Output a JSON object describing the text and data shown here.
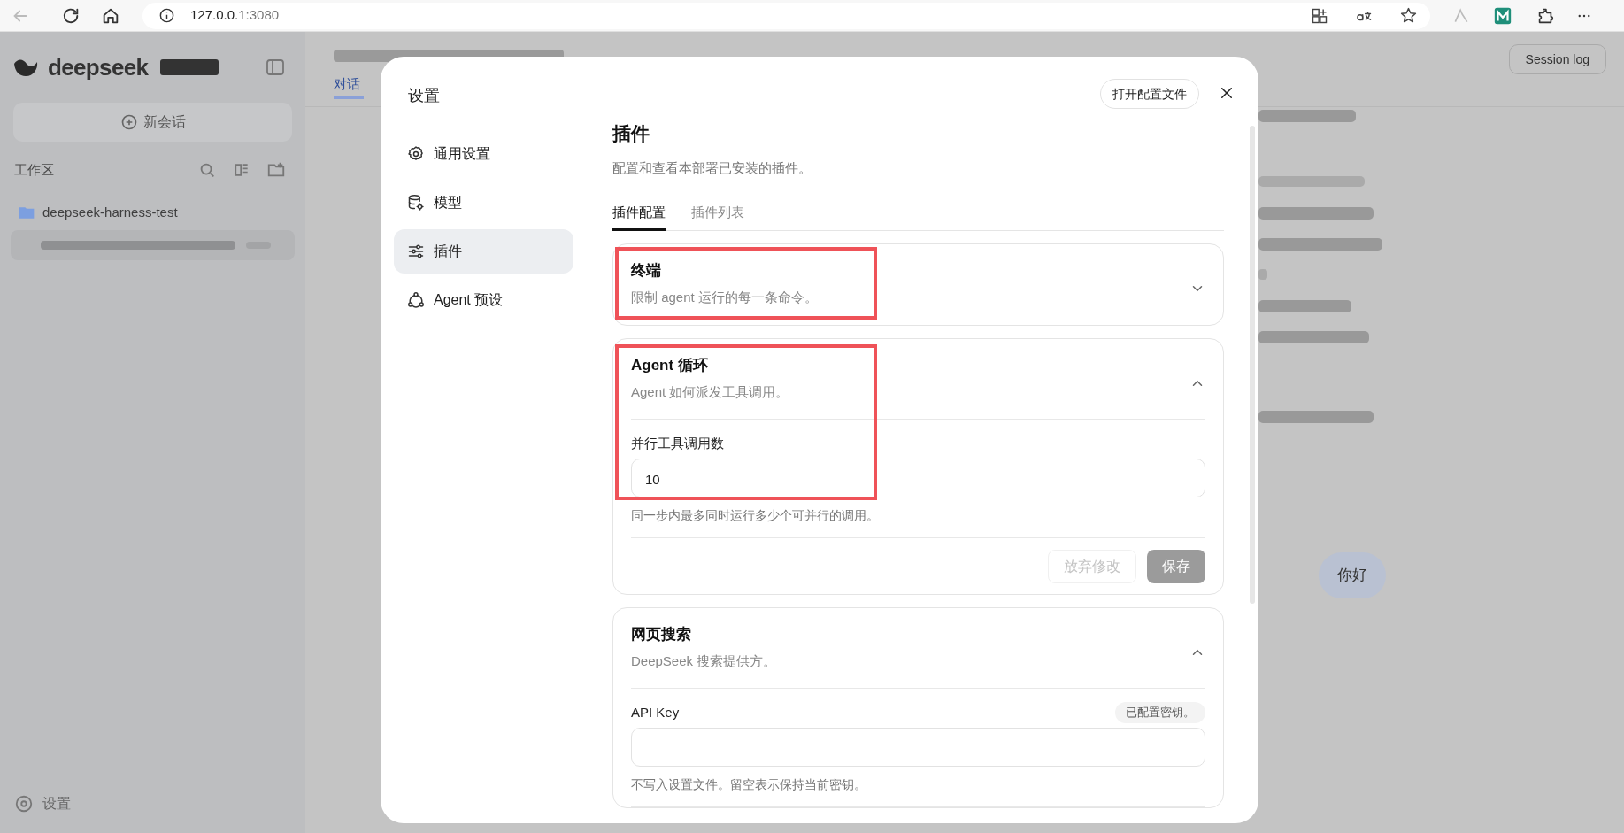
{
  "browser": {
    "address_host": "127.0.0.1",
    "address_port": ":3080"
  },
  "background": {
    "brand": "deepseek",
    "new_chat": "新会话",
    "workspace_label": "工作区",
    "folder": "deepseek-harness-test",
    "settings": "设置",
    "tab": "对话",
    "session_log": "Session log",
    "bubble": "你好"
  },
  "dialog": {
    "title": "设置",
    "open_config": "打开配置文件",
    "nav": [
      {
        "label": "通用设置",
        "selected": false
      },
      {
        "label": "模型",
        "selected": false
      },
      {
        "label": "插件",
        "selected": true
      },
      {
        "label": "Agent 预设",
        "selected": false
      }
    ],
    "heading": "插件",
    "description": "配置和查看本部署已安装的插件。",
    "tabs": [
      {
        "label": "插件配置",
        "selected": true
      },
      {
        "label": "插件列表",
        "selected": false
      }
    ],
    "plugins": [
      {
        "title": "终端",
        "description": "限制 agent 运行的每一条命令。",
        "expanded": false,
        "highlighted": true
      },
      {
        "title": "Agent 循环",
        "description": "Agent 如何派发工具调用。",
        "expanded": true,
        "highlighted": true,
        "fields": [
          {
            "label": "并行工具调用数",
            "value": "10",
            "hint": "同一步内最多同时运行多少个可并行的调用。"
          }
        ],
        "actions": [
          {
            "kind": "secondary",
            "label": "放弃修改",
            "disabled": true
          },
          {
            "kind": "primary",
            "label": "保存",
            "disabled": true
          }
        ]
      },
      {
        "title": "网页搜索",
        "description": "DeepSeek 搜索提供方。",
        "expanded": true,
        "highlighted": false,
        "fields": [
          {
            "label": "API Key",
            "badge": "已配置密钥。",
            "hint": "不写入设置文件。留空表示保持当前密钥。"
          }
        ]
      }
    ]
  }
}
